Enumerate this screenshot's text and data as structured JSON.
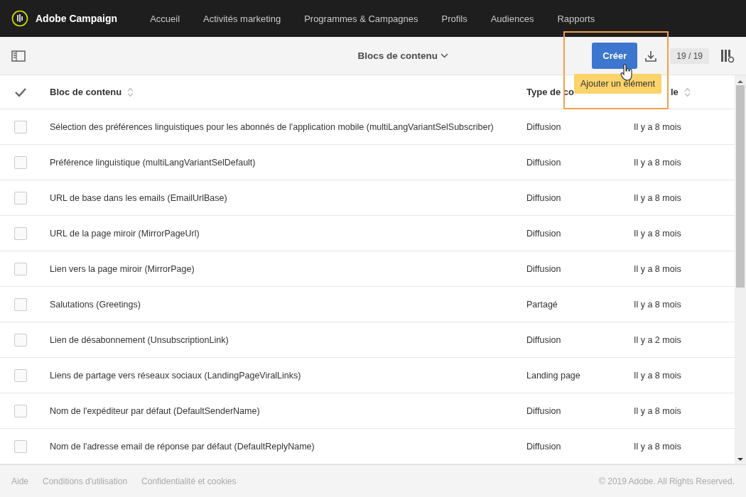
{
  "app": {
    "name": "Adobe Campaign"
  },
  "nav": [
    {
      "label": "Accueil"
    },
    {
      "label": "Activités marketing"
    },
    {
      "label": "Programmes & Campagnes"
    },
    {
      "label": "Profils"
    },
    {
      "label": "Audiences"
    },
    {
      "label": "Rapports"
    }
  ],
  "toolbar": {
    "title": "Blocs de contenu",
    "create_button": "Créer",
    "tooltip": "Ajouter un élément",
    "count": "19 / 19"
  },
  "table": {
    "columns": [
      {
        "label": "Bloc de contenu"
      },
      {
        "label": "Type de co"
      },
      {
        "label": "le"
      }
    ],
    "rows": [
      {
        "name": "Sélection des préférences linguistiques pour les abonnés de l'application mobile (multiLangVariantSelSubscriber)",
        "type": "Diffusion",
        "modified": "Il y a 8 mois",
        "checked": false
      },
      {
        "name": "Préférence linguistique (multiLangVariantSelDefault)",
        "type": "Diffusion",
        "modified": "Il y a 8 mois",
        "checked": false
      },
      {
        "name": "URL de base dans les emails (EmailUrlBase)",
        "type": "Diffusion",
        "modified": "Il y a 8 mois",
        "checked": false
      },
      {
        "name": "URL de la page miroir (MirrorPageUrl)",
        "type": "Diffusion",
        "modified": "Il y a 8 mois",
        "checked": false
      },
      {
        "name": "Lien vers la page miroir (MirrorPage)",
        "type": "Diffusion",
        "modified": "Il y a 8 mois",
        "checked": false
      },
      {
        "name": "Salutations (Greetings)",
        "type": "Partagé",
        "modified": "Il y a 8 mois",
        "checked": false
      },
      {
        "name": "Lien de désabonnement (UnsubscriptionLink)",
        "type": "Diffusion",
        "modified": "Il y a 2 mois",
        "checked": false
      },
      {
        "name": "Liens de partage vers réseaux sociaux (LandingPageViralLinks)",
        "type": "Landing page",
        "modified": "Il y a 8 mois",
        "checked": false
      },
      {
        "name": "Nom de l'expéditeur par défaut (DefaultSenderName)",
        "type": "Diffusion",
        "modified": "Il y a 8 mois",
        "checked": false
      },
      {
        "name": "Nom de l'adresse email de réponse par défaut (DefaultReplyName)",
        "type": "Diffusion",
        "modified": "Il y a 8 mois",
        "checked": false
      }
    ]
  },
  "footer": {
    "links": [
      {
        "label": "Aide"
      },
      {
        "label": "Conditions d'utilisation"
      },
      {
        "label": "Confidentialité et cookies"
      }
    ],
    "copyright": "© 2019 Adobe. All Rights Reserved."
  }
}
